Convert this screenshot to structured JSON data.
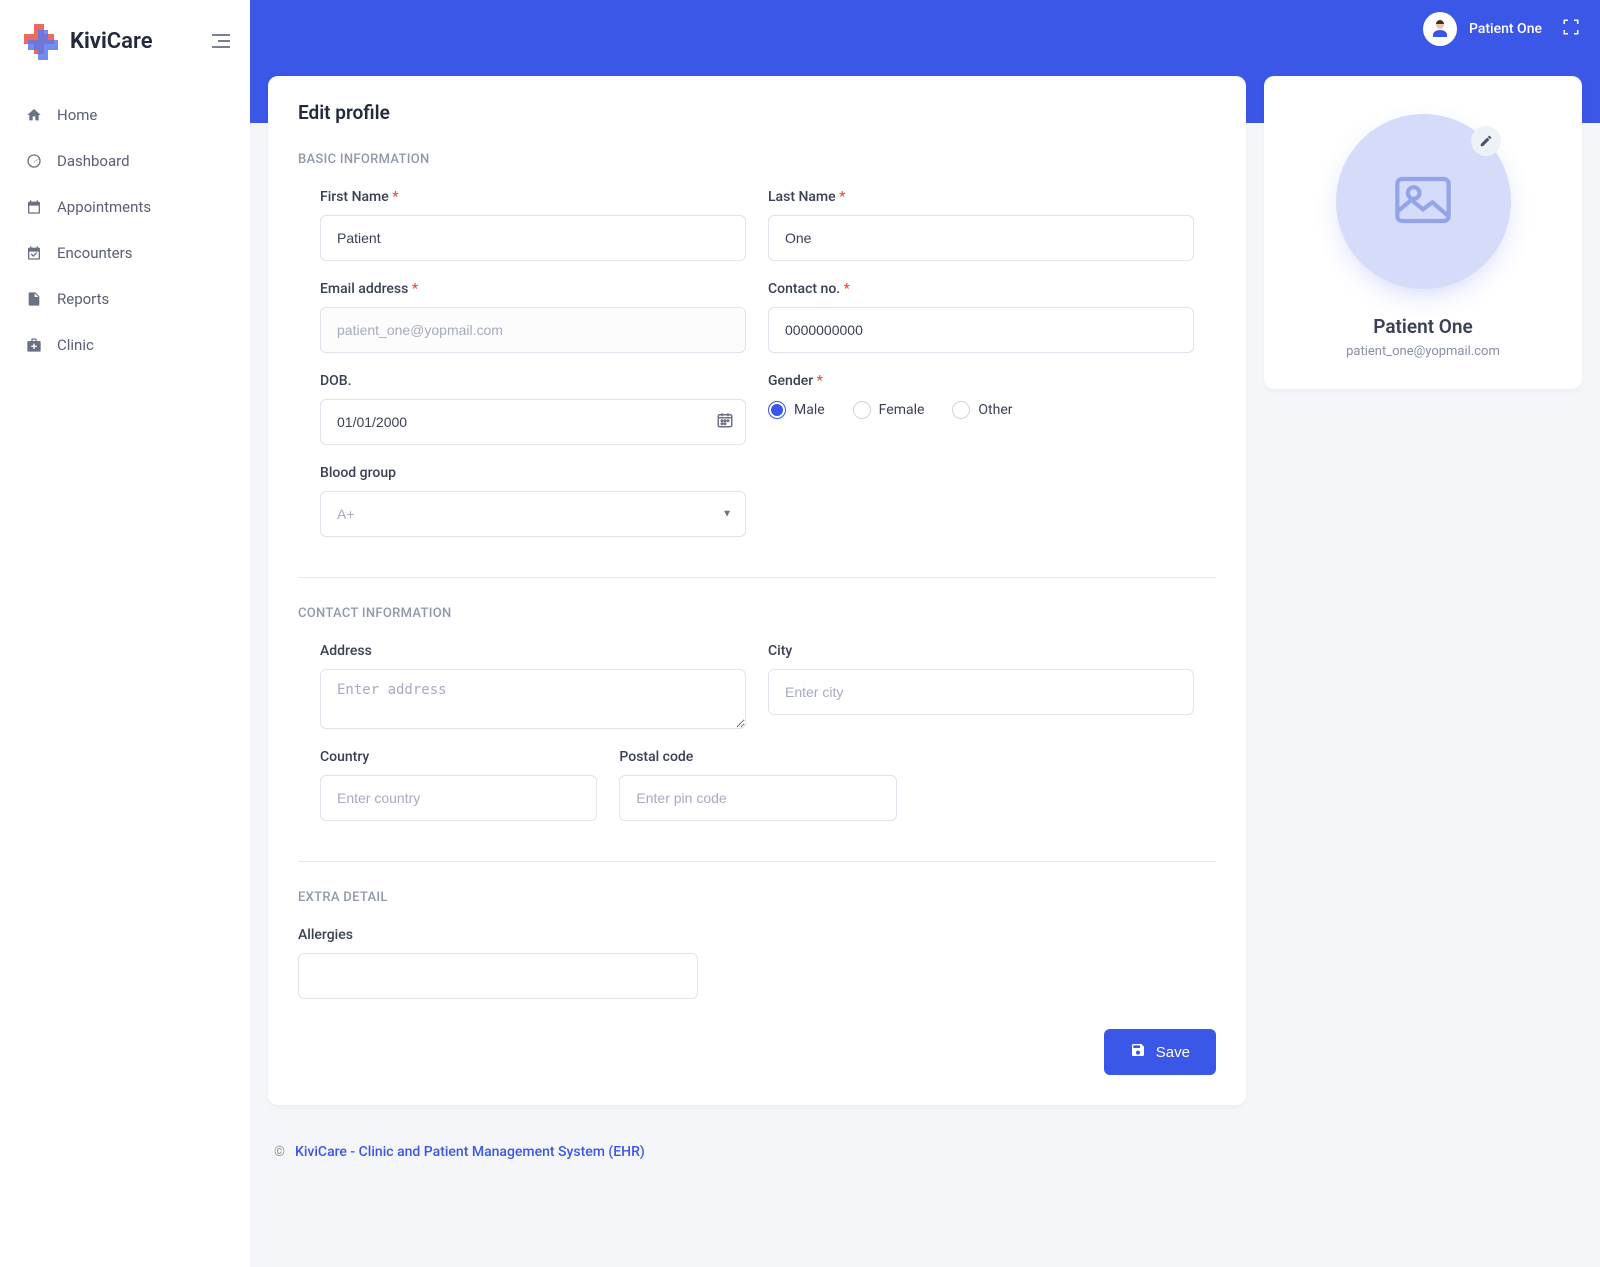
{
  "brand": {
    "name": "KiviCare",
    "name_bold": "Kivi",
    "name_light": "Care"
  },
  "user": {
    "display_name": "Patient One"
  },
  "sidebar": {
    "items": [
      {
        "label": "Home"
      },
      {
        "label": "Dashboard"
      },
      {
        "label": "Appointments"
      },
      {
        "label": "Encounters"
      },
      {
        "label": "Reports"
      },
      {
        "label": "Clinic"
      }
    ]
  },
  "page": {
    "title": "Edit profile",
    "sections": {
      "basic": "BASIC INFORMATION",
      "contact": "CONTACT INFORMATION",
      "extra": "EXTRA DETAIL"
    },
    "labels": {
      "first_name": "First Name",
      "last_name": "Last Name",
      "email": "Email address",
      "contact": "Contact no.",
      "dob": "DOB.",
      "gender": "Gender",
      "blood_group": "Blood group",
      "address": "Address",
      "city": "City",
      "country": "Country",
      "postal": "Postal code",
      "allergies": "Allergies"
    },
    "values": {
      "first_name": "Patient",
      "last_name": "One",
      "email": "patient_one@yopmail.com",
      "contact": "0000000000",
      "dob": "01/01/2000",
      "blood_group": "A+",
      "gender_selected": "male"
    },
    "placeholders": {
      "address": "Enter address",
      "city": "Enter city",
      "country": "Enter country",
      "postal": "Enter pin code"
    },
    "gender_options": {
      "male": "Male",
      "female": "Female",
      "other": "Other"
    },
    "actions": {
      "save": "Save"
    }
  },
  "profile_card": {
    "name": "Patient One",
    "email": "patient_one@yopmail.com"
  },
  "footer": {
    "text": "KiviCare - Clinic and Patient Management System (EHR)"
  }
}
